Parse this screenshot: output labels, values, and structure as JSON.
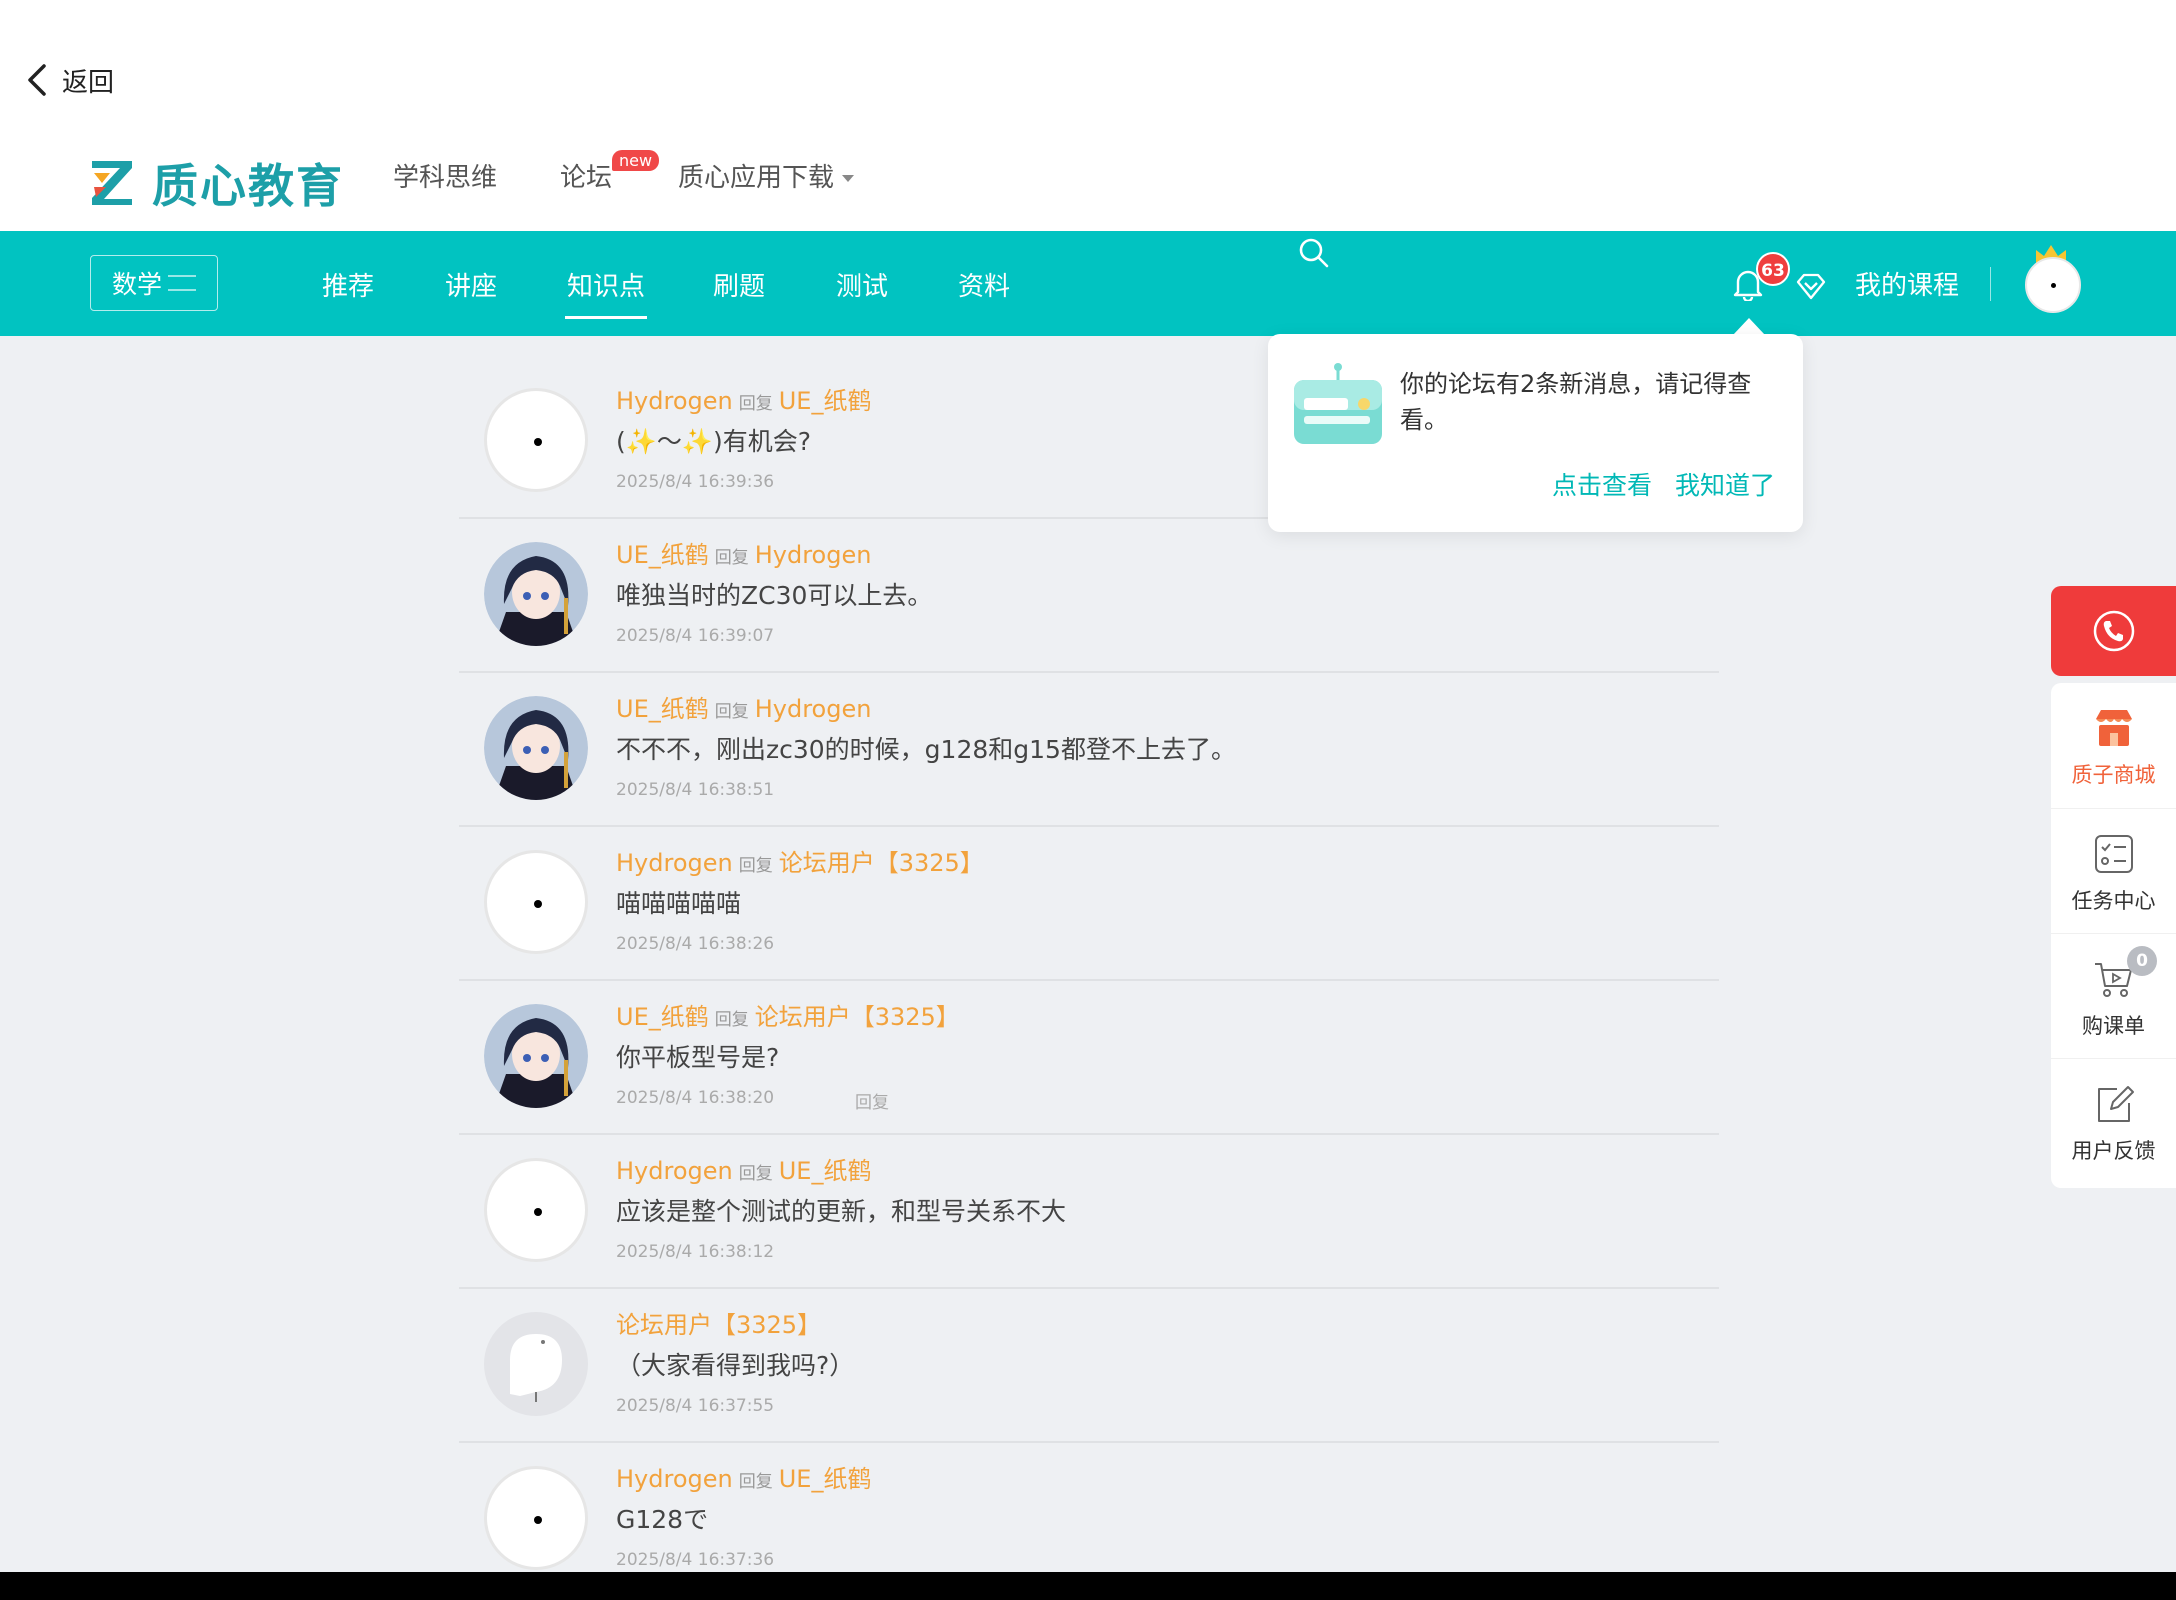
{
  "header": {
    "back_label": "返回",
    "logo_text": "质心教育",
    "nav": [
      {
        "label": "学科思维"
      },
      {
        "label": "论坛",
        "badge": "new"
      },
      {
        "label": "质心应用下载"
      }
    ]
  },
  "navbar": {
    "subject": "数学",
    "tabs": [
      "推荐",
      "讲座",
      "知识点",
      "刷题",
      "测试",
      "资料"
    ],
    "active_tab": "知识点",
    "notification_count": "63",
    "my_courses": "我的课程",
    "accent_color": "#01c3c1"
  },
  "posts": [
    {
      "author": "Hydrogen",
      "reply_word": "回复",
      "target": "UE_纸鹤",
      "content": "(✨～✨)有机会?",
      "time": "2025/8/4 16:39:36",
      "avatar": "blank"
    },
    {
      "author": "UE_纸鹤",
      "reply_word": "回复",
      "target": "Hydrogen",
      "content": "唯独当时的ZC30可以上去。",
      "time": "2025/8/4 16:39:07",
      "avatar": "anime"
    },
    {
      "author": "UE_纸鹤",
      "reply_word": "回复",
      "target": "Hydrogen",
      "content": "不不不，刚出zc30的时候，g128和g15都登不上去了。",
      "time": "2025/8/4 16:38:51",
      "avatar": "anime"
    },
    {
      "author": "Hydrogen",
      "reply_word": "回复",
      "target": "论坛用户【3325】",
      "content": "喵喵喵喵喵",
      "time": "2025/8/4 16:38:26",
      "avatar": "blank"
    },
    {
      "author": "UE_纸鹤",
      "reply_word": "回复",
      "target": "论坛用户【3325】",
      "content": "你平板型号是?",
      "time": "2025/8/4 16:38:20",
      "avatar": "anime",
      "reply_link": "回复"
    },
    {
      "author": "Hydrogen",
      "reply_word": "回复",
      "target": "UE_纸鹤",
      "content": "应该是整个测试的更新，和型号关系不大",
      "time": "2025/8/4 16:38:12",
      "avatar": "blank"
    },
    {
      "author": "论坛用户【3325】",
      "reply_word": "",
      "target": "",
      "content": "（大家看得到我吗?）",
      "time": "2025/8/4 16:37:55",
      "avatar": "ghost"
    },
    {
      "author": "Hydrogen",
      "reply_word": "回复",
      "target": "UE_纸鹤",
      "content": "G128で",
      "time": "2025/8/4 16:37:36",
      "avatar": "blank"
    }
  ],
  "popup": {
    "message": "你的论坛有2条新消息，请记得查看。",
    "view_button": "点击查看",
    "dismiss_button": "我知道了"
  },
  "sidebar": {
    "items": [
      {
        "label": "质子商城",
        "icon": "shop-icon",
        "color": "#f0623a"
      },
      {
        "label": "任务中心",
        "icon": "task-icon"
      },
      {
        "label": "购课单",
        "icon": "cart-icon",
        "badge": "0"
      },
      {
        "label": "用户反馈",
        "icon": "feedback-icon"
      }
    ]
  }
}
